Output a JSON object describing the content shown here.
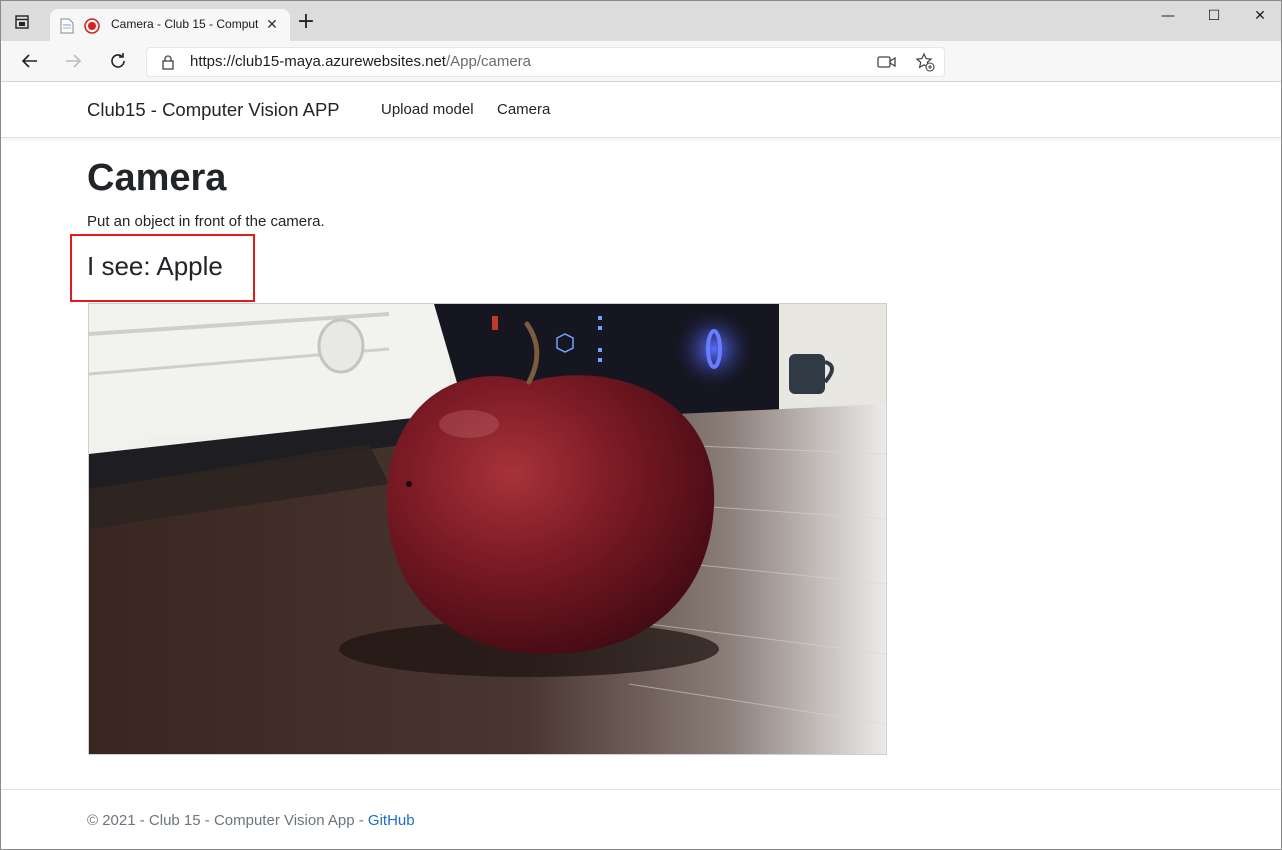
{
  "browser": {
    "tab_title": "Camera - Club 15 - Comput",
    "tab_close": "✕",
    "new_tab": "+",
    "url_host": "https://club15-maya.azurewebsites.net",
    "url_path": "/App/camera",
    "window_controls": {
      "minimize": "—",
      "maximize": "☐",
      "close": "✕"
    },
    "icons": [
      "tab-actions-icon",
      "page-icon",
      "recording-icon",
      "back-icon",
      "forward-icon",
      "refresh-icon",
      "lock-icon",
      "camera-permission-icon",
      "add-favorite-icon"
    ]
  },
  "navbar": {
    "brand": "Club15 - Computer Vision APP",
    "links": [
      {
        "label": "Upload model"
      },
      {
        "label": "Camera"
      }
    ]
  },
  "main": {
    "title": "Camera",
    "instruction": "Put an object in front of the camera.",
    "result": "I see: Apple",
    "highlight_color": "#e21a1a"
  },
  "footer": {
    "text": "© 2021 - Club 15 - Computer Vision App - ",
    "link": "GitHub",
    "link_color": "#1b6ec2"
  }
}
